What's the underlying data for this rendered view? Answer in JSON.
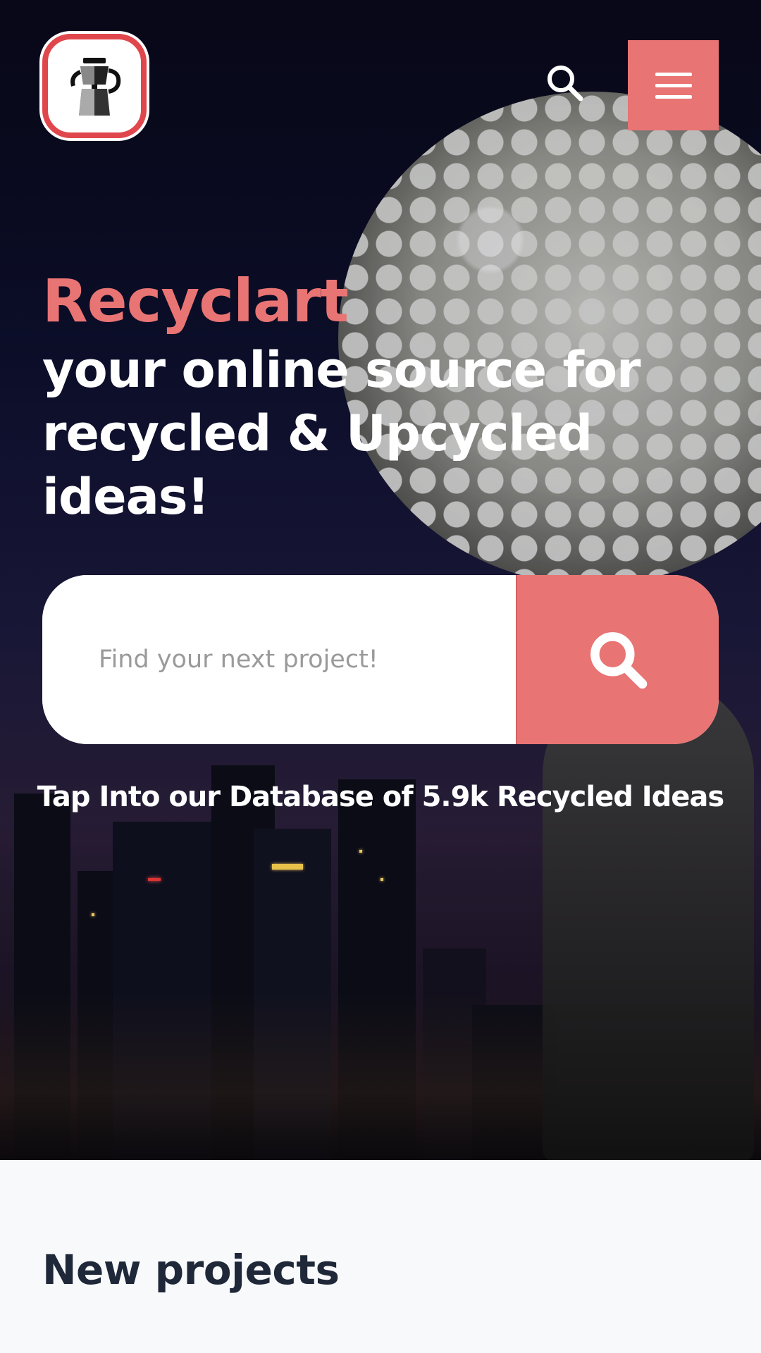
{
  "header": {
    "logo_icon": "moka-pot-logo-icon",
    "search_icon": "search-icon",
    "menu_icon": "hamburger-menu-icon"
  },
  "hero": {
    "brand": "Recyclart",
    "tagline": "your online source for recycled & Upcycled ideas!",
    "search": {
      "placeholder": "Find your next project!",
      "value": "",
      "button_icon": "search-icon"
    },
    "database_text": "Tap Into our Database of 5.9k Recycled Ideas"
  },
  "sections": {
    "new_projects_title": "New projects"
  },
  "colors": {
    "accent": "#e97474",
    "logo_border": "#e0474c",
    "heading_dark": "#1f2838",
    "page_bg": "#f8f9fb"
  }
}
